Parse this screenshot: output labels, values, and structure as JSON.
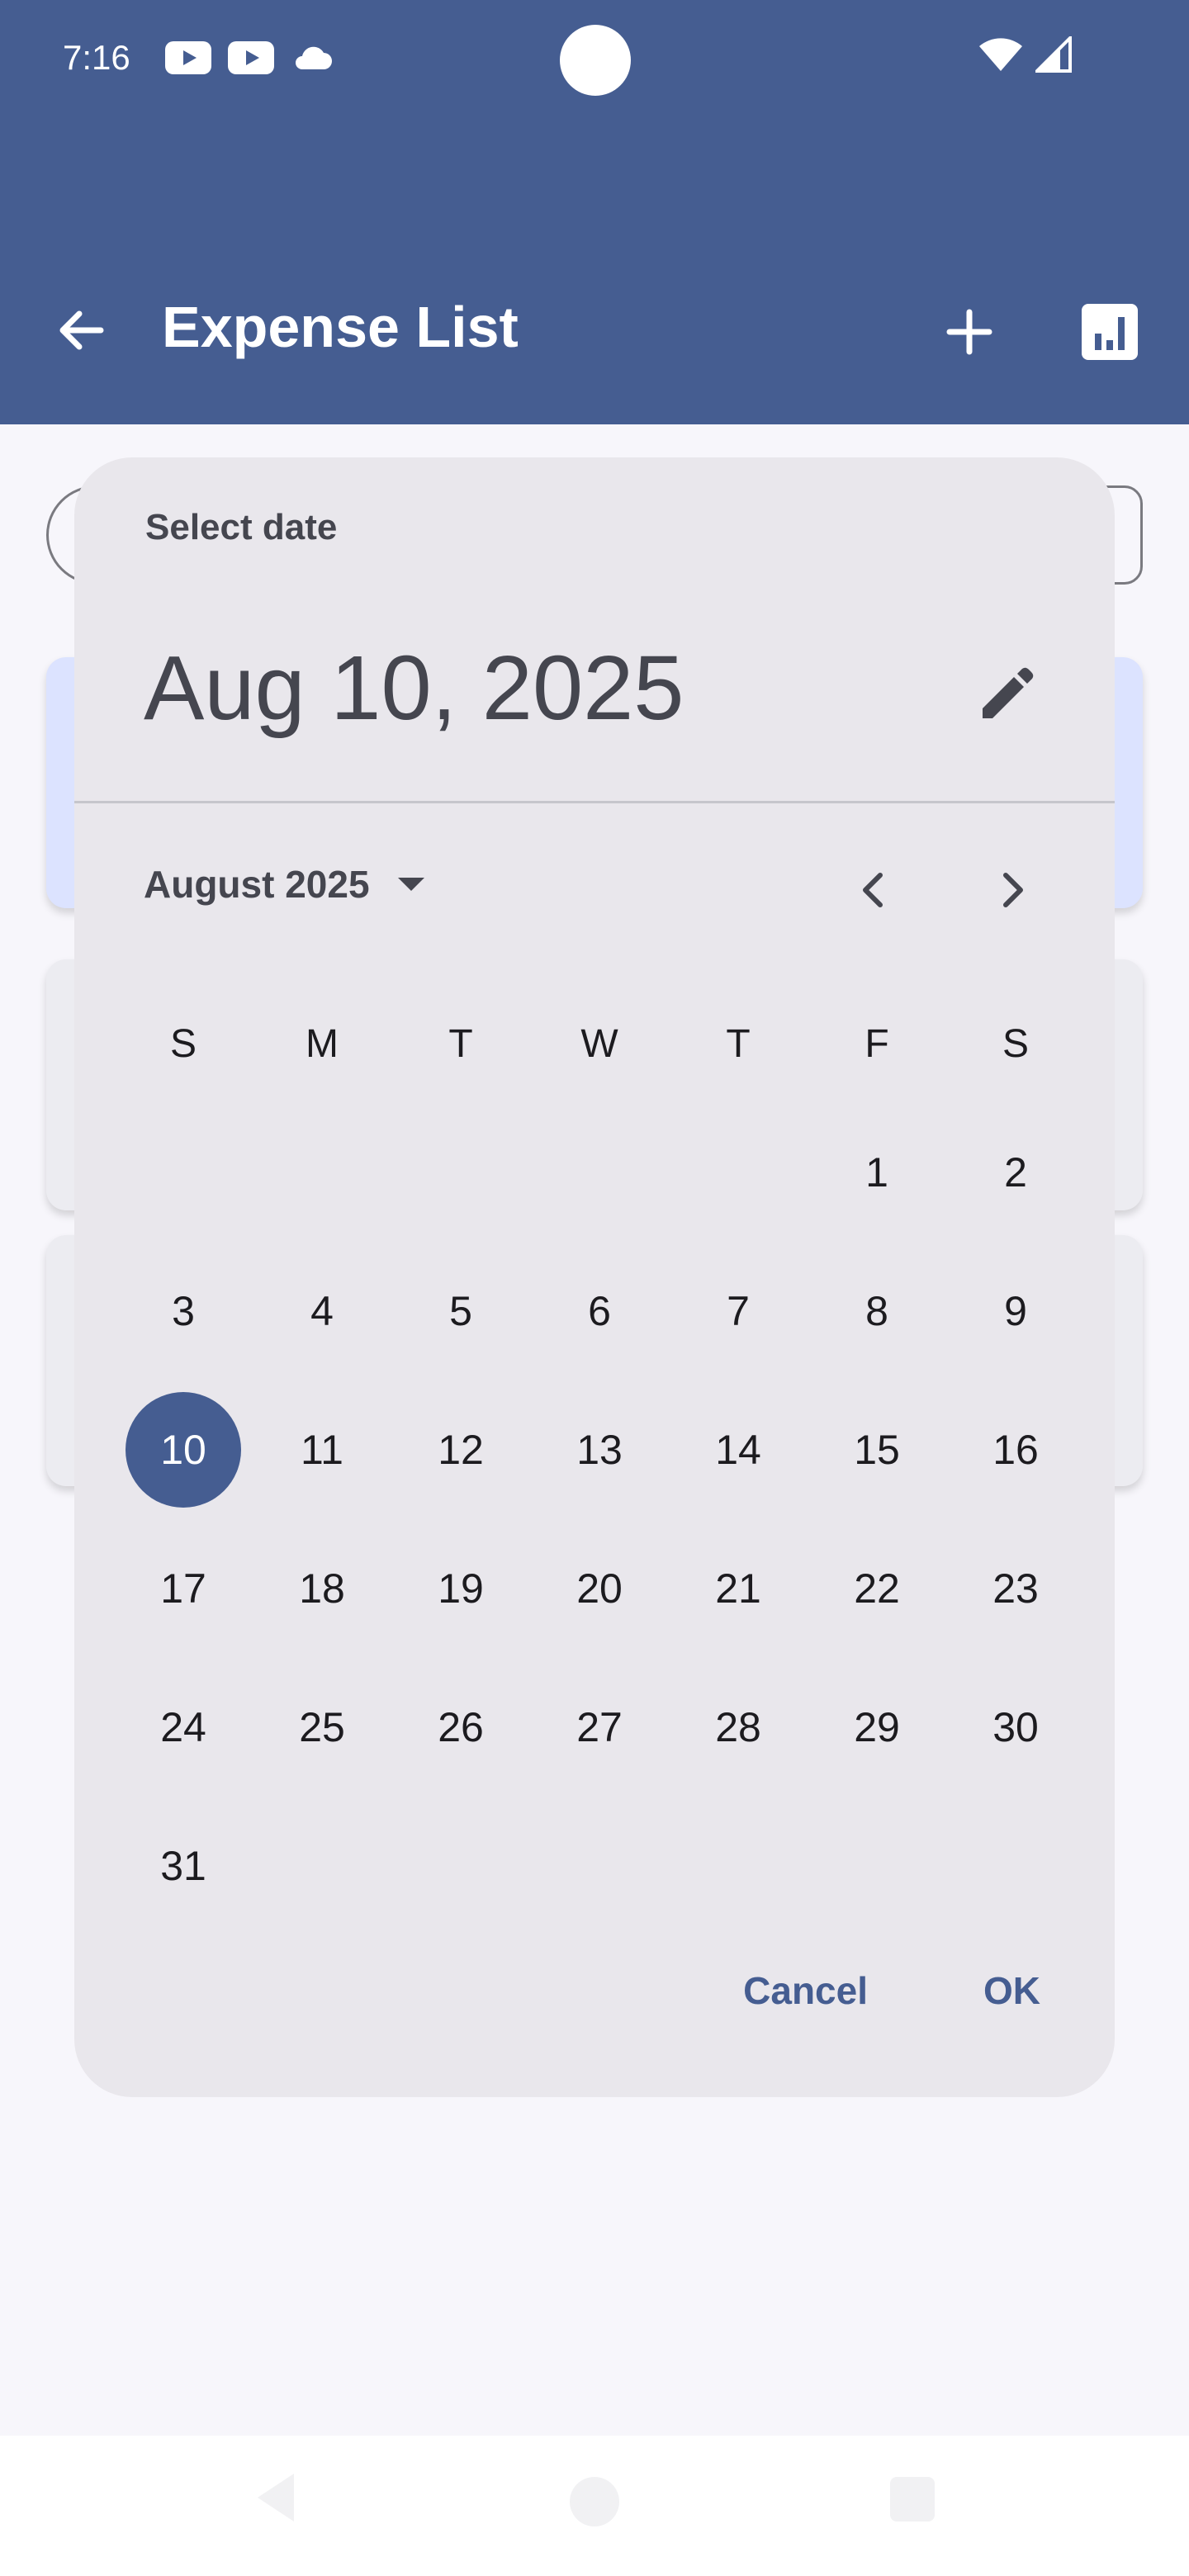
{
  "status_bar": {
    "time": "7:16"
  },
  "app_bar": {
    "title": "Expense List"
  },
  "date_picker": {
    "headline": "Select date",
    "selected_date": "Aug 10, 2025",
    "month_year": "August 2025",
    "weekdays": [
      "S",
      "M",
      "T",
      "W",
      "T",
      "F",
      "S"
    ],
    "weeks": [
      [
        "",
        "",
        "",
        "",
        "",
        "1",
        "2"
      ],
      [
        "3",
        "4",
        "5",
        "6",
        "7",
        "8",
        "9"
      ],
      [
        "10",
        "11",
        "12",
        "13",
        "14",
        "15",
        "16"
      ],
      [
        "17",
        "18",
        "19",
        "20",
        "21",
        "22",
        "23"
      ],
      [
        "24",
        "25",
        "26",
        "27",
        "28",
        "29",
        "30"
      ],
      [
        "31",
        "",
        "",
        "",
        "",
        "",
        ""
      ]
    ],
    "selected_day": "10",
    "cancel_label": "Cancel",
    "ok_label": "OK"
  },
  "colors": {
    "primary": "#455d91",
    "dialog": "#e9e7ec"
  }
}
